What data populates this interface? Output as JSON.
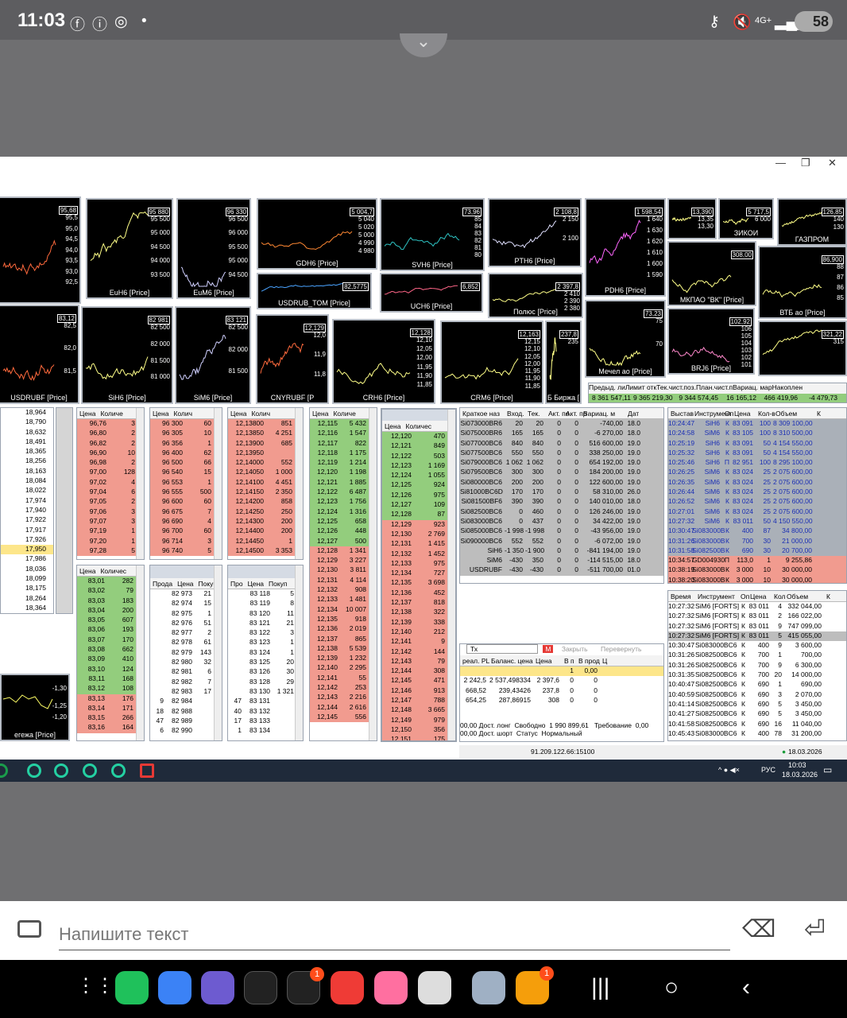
{
  "status_bar": {
    "time": "11:03",
    "battery": "58",
    "network": "4G+"
  },
  "window": {
    "min": "—",
    "restore": "❐",
    "close": "✕"
  },
  "charts": [
    {
      "caption": "",
      "price": "95,68",
      "axis": [
        "95,5",
        "95,0",
        "94,5",
        "94,0",
        "93,5",
        "93,0",
        "92,5"
      ]
    },
    {
      "caption": "EuH6 [Price]",
      "price": "95 880",
      "axis": [
        "95 500",
        "95 000",
        "94 500",
        "94 000",
        "93 500"
      ]
    },
    {
      "caption": "EuM6 [Price]",
      "price": "96 330",
      "axis": [
        "96 500",
        "96 000",
        "95 500",
        "95 000",
        "94 500"
      ]
    },
    {
      "caption": "GDH6 [Price]",
      "price": "5 004,7",
      "axis": [
        "5 040",
        "5 020",
        "5 000",
        "4 990",
        "4 980"
      ]
    },
    {
      "caption": "USDRUB_TOM [Price]",
      "price": "82,5775",
      "axis": []
    },
    {
      "caption": "SVH6 [Price]",
      "price": "73,96",
      "axis": [
        "85",
        "84",
        "83",
        "82",
        "81",
        "80"
      ]
    },
    {
      "caption": "UCH6 [Price]",
      "price": "6,852",
      "axis": []
    },
    {
      "caption": "PTH6 [Price]",
      "price": "2 108,8",
      "axis": [
        "2 150",
        "2 100"
      ]
    },
    {
      "caption": "Полюс [Price]",
      "price": "2 397,8",
      "axis": [
        "2 410",
        "2 390",
        "2 380"
      ]
    },
    {
      "caption": "PDH6 [Price]",
      "price": "1 598,54",
      "axis": [
        "1 640",
        "1 630",
        "1 620",
        "1 610",
        "1 600",
        "1 590"
      ]
    },
    {
      "caption": "",
      "price": "13,390",
      "axis": [
        "13,35",
        "13,30"
      ]
    },
    {
      "caption": "ЗИКОИ",
      "price": "5 717,5",
      "axis": [
        "6 000"
      ]
    },
    {
      "caption": "ГАЗПРОМ",
      "price": "126,85",
      "axis": [
        "140",
        "130"
      ]
    },
    {
      "caption": "МКПАО \"ВК\" [Price]",
      "price": "308,00",
      "axis": []
    },
    {
      "caption": "ВТБ ао [Price]",
      "price": "86,900",
      "axis": [
        "88",
        "87",
        "86",
        "85"
      ]
    },
    {
      "caption": "USDRUBF [Price]",
      "price": "83,12",
      "axis": [
        "82,5",
        "82,0",
        "81,5"
      ]
    },
    {
      "caption": "SiH6 [Price]",
      "price": "82 981",
      "axis": [
        "82 500",
        "82 000",
        "81 500",
        "81 000"
      ]
    },
    {
      "caption": "SiM6 [Price]",
      "price": "83 121",
      "axis": [
        "82 500",
        "82 000",
        "81 500"
      ]
    },
    {
      "caption": "CNYRUBF [P",
      "price": "12,129",
      "axis": [
        "12,0",
        "11,9",
        "11,8"
      ]
    },
    {
      "caption": "CRH6 [Price]",
      "price": "12,128",
      "axis": [
        "12,10",
        "12,05",
        "12,00",
        "11,95",
        "11,90",
        "11,85"
      ]
    },
    {
      "caption": "CRM6 [Price]",
      "price": "12,163",
      "axis": [
        "12,15",
        "12,10",
        "12,05",
        "12,00",
        "11,95",
        "11,90",
        "11,85"
      ]
    },
    {
      "caption": "Б Биржа [",
      "price": "237,8",
      "axis": [
        "235"
      ]
    },
    {
      "caption": "Мечел ао [Price]",
      "price": "73,23",
      "axis": [
        "75",
        "70"
      ]
    },
    {
      "caption": "BRJ6 [Price]",
      "price": "102,92",
      "axis": [
        "106",
        "105",
        "104",
        "103",
        "102",
        "101"
      ]
    },
    {
      "caption": "",
      "price": "321,22",
      "axis": [
        "315"
      ]
    }
  ],
  "summary_strip": {
    "headers": [
      "Предыд. ли",
      "Лимит отк",
      "Тек.чист.поз.",
      "План.чист.п",
      "Вариац. мар",
      "Накоплен"
    ],
    "values": [
      "8 361 547,11",
      "9 365 219,30",
      "9 344 574,45",
      "16 165,12",
      "466 419,96",
      "-4 479,73"
    ]
  },
  "left_list": [
    "18,964",
    "18,790",
    "18,632",
    "18,491",
    "18,365",
    "18,256",
    "18,163",
    "18,084",
    "18,022",
    "17,974",
    "17,940",
    "17,922",
    "17,917",
    "17,926",
    "17,950",
    "17,986",
    "18,036",
    "18,099",
    "18,175",
    "18,264",
    "18,364"
  ],
  "depth_headers": {
    "price": "Цена",
    "qty": "Количе",
    "qty2": "Колич",
    "qty3": "Количес",
    "sell": "Прода",
    "buy": "Покуп",
    "pro": "Про"
  },
  "depth_eu": [
    [
      "96,76",
      "3"
    ],
    [
      "96,80",
      "2"
    ],
    [
      "96,82",
      "2"
    ],
    [
      "96,90",
      "10"
    ],
    [
      "96,98",
      "2"
    ],
    [
      "97,00",
      "128"
    ],
    [
      "97,02",
      "4"
    ],
    [
      "97,04",
      "6"
    ],
    [
      "97,05",
      "2"
    ],
    [
      "97,06",
      "3"
    ],
    [
      "97,07",
      "3"
    ],
    [
      "97,19",
      "1"
    ],
    [
      "97,20",
      "1"
    ],
    [
      "97,28",
      "5"
    ]
  ],
  "depth_eum": [
    [
      "96 300",
      "60"
    ],
    [
      "96 305",
      "10"
    ],
    [
      "96 356",
      "1"
    ],
    [
      "96 400",
      "62"
    ],
    [
      "96 500",
      "66"
    ],
    [
      "96 540",
      "15"
    ],
    [
      "96 553",
      "1"
    ],
    [
      "96 555",
      "500"
    ],
    [
      "96 600",
      "60"
    ],
    [
      "96 675",
      "7"
    ],
    [
      "96 690",
      "4"
    ],
    [
      "96 700",
      "60"
    ],
    [
      "96 714",
      "3"
    ],
    [
      "96 740",
      "5"
    ]
  ],
  "depth_cny": [
    [
      "12,13800",
      "851"
    ],
    [
      "12,13850",
      "4 251"
    ],
    [
      "12,13900",
      "685"
    ],
    [
      "12,13950",
      ""
    ],
    [
      "12,14000",
      "552"
    ],
    [
      "12,14050",
      "1 000"
    ],
    [
      "12,14100",
      "4 451"
    ],
    [
      "12,14150",
      "2 350"
    ],
    [
      "12,14200",
      "858"
    ],
    [
      "12,14250",
      "250"
    ],
    [
      "12,14300",
      "200"
    ],
    [
      "12,14400",
      "200"
    ],
    [
      "12,14450",
      "1"
    ],
    [
      "12,14500",
      "3 353"
    ]
  ],
  "depth_crh_top": [
    [
      "12,115",
      "5 432"
    ],
    [
      "12,116",
      "1 547"
    ],
    [
      "12,117",
      "822"
    ],
    [
      "12,118",
      "1 175"
    ],
    [
      "12,119",
      "1 214"
    ],
    [
      "12,120",
      "1 198"
    ],
    [
      "12,121",
      "1 885"
    ],
    [
      "12,122",
      "6 487"
    ],
    [
      "12,123",
      "1 756"
    ],
    [
      "12,124",
      "1 316"
    ],
    [
      "12,125",
      "658"
    ],
    [
      "12,126",
      "448"
    ],
    [
      "12,127",
      "500"
    ],
    [
      "12,128",
      "1 341"
    ],
    [
      "12,129",
      "3 227"
    ],
    [
      "12,130",
      "3 811"
    ],
    [
      "12,131",
      "4 114"
    ],
    [
      "12,132",
      "908"
    ],
    [
      "12,133",
      "1 481"
    ],
    [
      "12,134",
      "10 007"
    ],
    [
      "12,135",
      "918"
    ],
    [
      "12,136",
      "2 019"
    ],
    [
      "12,137",
      "865"
    ],
    [
      "12,138",
      "5 539"
    ],
    [
      "12,139",
      "1 232"
    ],
    [
      "12,140",
      "2 295"
    ],
    [
      "12,141",
      "55"
    ],
    [
      "12,142",
      "253"
    ],
    [
      "12,143",
      "2 216"
    ],
    [
      "12,144",
      "2 616"
    ],
    [
      "12,145",
      "556"
    ]
  ],
  "depth_crm": [
    [
      "12,120",
      "470"
    ],
    [
      "12,121",
      "849"
    ],
    [
      "12,122",
      "503"
    ],
    [
      "12,123",
      "1 169"
    ],
    [
      "12,124",
      "1 055"
    ],
    [
      "12,125",
      "924"
    ],
    [
      "12,126",
      "975"
    ],
    [
      "12,127",
      "109"
    ],
    [
      "12,128",
      "87"
    ],
    [
      "12,129",
      "923"
    ],
    [
      "12,130",
      "2 769"
    ],
    [
      "12,131",
      "1 415"
    ],
    [
      "12,132",
      "1 452"
    ],
    [
      "12,133",
      "975"
    ],
    [
      "12,134",
      "727"
    ],
    [
      "12,135",
      "3 698"
    ],
    [
      "12,136",
      "452"
    ],
    [
      "12,137",
      "818"
    ],
    [
      "12,138",
      "322"
    ],
    [
      "12,139",
      "338"
    ],
    [
      "12,140",
      "212"
    ],
    [
      "12,141",
      "9"
    ],
    [
      "12,142",
      "144"
    ],
    [
      "12,143",
      "79"
    ],
    [
      "12,144",
      "308"
    ],
    [
      "12,145",
      "471"
    ],
    [
      "12,146",
      "913"
    ],
    [
      "12,147",
      "788"
    ],
    [
      "12,148",
      "3 665"
    ],
    [
      "12,149",
      "979"
    ],
    [
      "12,150",
      "356"
    ],
    [
      "12,151",
      "175"
    ]
  ],
  "depth_usd": [
    [
      "83,01",
      "282"
    ],
    [
      "83,02",
      "79"
    ],
    [
      "83,03",
      "183"
    ],
    [
      "83,04",
      "200"
    ],
    [
      "83,05",
      "607"
    ],
    [
      "83,06",
      "193"
    ],
    [
      "83,07",
      "170"
    ],
    [
      "83,08",
      "662"
    ],
    [
      "83,09",
      "410"
    ],
    [
      "83,10",
      "124"
    ],
    [
      "83,11",
      "168"
    ],
    [
      "83,12",
      "108"
    ],
    [
      "83,13",
      "176"
    ],
    [
      "83,14",
      "171"
    ],
    [
      "83,15",
      "266"
    ],
    [
      "83,16",
      "164"
    ]
  ],
  "depth_sih": [
    [
      "",
      "82 973",
      "21"
    ],
    [
      "",
      "82 974",
      "15"
    ],
    [
      "",
      "82 975",
      "1"
    ],
    [
      "",
      "82 976",
      "51"
    ],
    [
      "",
      "82 977",
      "2"
    ],
    [
      "",
      "82 978",
      "61"
    ],
    [
      "",
      "82 979",
      "143"
    ],
    [
      "",
      "82 980",
      "32"
    ],
    [
      "",
      "82 981",
      "6"
    ],
    [
      "",
      "82 982",
      "7"
    ],
    [
      "",
      "82 983",
      "17"
    ],
    [
      "9",
      "82 984",
      ""
    ],
    [
      "18",
      "82 988",
      ""
    ],
    [
      "47",
      "82 989",
      ""
    ],
    [
      "6",
      "82 990",
      ""
    ]
  ],
  "depth_sim": [
    [
      "",
      "83 118",
      "5"
    ],
    [
      "",
      "83 119",
      "8"
    ],
    [
      "",
      "83 120",
      "11"
    ],
    [
      "",
      "83 121",
      "21"
    ],
    [
      "",
      "83 122",
      "3"
    ],
    [
      "",
      "83 123",
      "1"
    ],
    [
      "",
      "83 124",
      "1"
    ],
    [
      "",
      "83 125",
      "20"
    ],
    [
      "",
      "83 126",
      "30"
    ],
    [
      "",
      "83 128",
      "29"
    ],
    [
      "",
      "83 130",
      "1 321"
    ],
    [
      "47",
      "83 131",
      ""
    ],
    [
      "40",
      "83 132",
      ""
    ],
    [
      "17",
      "83 133",
      ""
    ],
    [
      "1",
      "83 134",
      ""
    ]
  ],
  "positions": {
    "headers": [
      "Краткое наз",
      "Вход.",
      "Тек.",
      "Акт. по",
      "Акт. пр",
      "Вариац. м",
      "Дат"
    ],
    "rows": [
      [
        "Si073000BR6",
        "20",
        "20",
        "0",
        "0",
        "-740,00",
        "18.0"
      ],
      [
        "Si075000BR6",
        "165",
        "165",
        "0",
        "0",
        "-6 270,00",
        "18.0"
      ],
      [
        "Si077000BC6",
        "840",
        "840",
        "0",
        "0",
        "516 600,00",
        "19.0"
      ],
      [
        "Si077500BC6",
        "550",
        "550",
        "0",
        "0",
        "338 250,00",
        "19.0"
      ],
      [
        "Si079000BC6",
        "1 062",
        "1 062",
        "0",
        "0",
        "654 192,00",
        "19.0"
      ],
      [
        "Si079500BC6",
        "300",
        "300",
        "0",
        "0",
        "184 200,00",
        "19.0"
      ],
      [
        "Si080000BC6",
        "200",
        "200",
        "0",
        "0",
        "122 600,00",
        "19.0"
      ],
      [
        "Si81000BC6D",
        "170",
        "170",
        "0",
        "0",
        "58 310,00",
        "26.0"
      ],
      [
        "Si081500BF6",
        "390",
        "390",
        "0",
        "0",
        "140 010,00",
        "18.0"
      ],
      [
        "Si082500BC6",
        "0",
        "460",
        "0",
        "0",
        "126 246,00",
        "19.0"
      ],
      [
        "Si083000BC6",
        "0",
        "437",
        "0",
        "0",
        "34 422,00",
        "19.0"
      ],
      [
        "Si085000BC6",
        "-1 998",
        "-1 998",
        "0",
        "0",
        "-43 956,00",
        "19.0"
      ],
      [
        "Si090000BC6",
        "552",
        "552",
        "0",
        "0",
        "-6 072,00",
        "19.0"
      ],
      [
        "SiH6",
        "-1 350",
        "-1 900",
        "0",
        "0",
        "-841 194,00",
        "19.0"
      ],
      [
        "SiM6",
        "-430",
        "350",
        "0",
        "0",
        "-114 515,00",
        "18.0"
      ],
      [
        "USDRUBF",
        "-430",
        "-430",
        "0",
        "0",
        "-511 700,00",
        "01.0"
      ]
    ]
  },
  "orders": {
    "headers": [
      "Выстав",
      "Инструмент",
      "Оп",
      "Цена",
      "Кол-в",
      "Объем",
      "К"
    ],
    "rows": [
      [
        "10:24:47",
        "SiH6",
        "К",
        "83 091",
        "100",
        "8 309 100,00"
      ],
      [
        "10:24:58",
        "SiM6",
        "К",
        "83 105",
        "100",
        "8 310 500,00"
      ],
      [
        "10:25:19",
        "SiH6",
        "К",
        "83 091",
        "50",
        "4 154 550,00"
      ],
      [
        "10:25:32",
        "SiH6",
        "К",
        "83 091",
        "50",
        "4 154 550,00"
      ],
      [
        "10:25:46",
        "SiH6",
        "П",
        "82 951",
        "100",
        "8 295 100,00"
      ],
      [
        "10:26:25",
        "SiM6",
        "К",
        "83 024",
        "25",
        "2 075 600,00"
      ],
      [
        "10:26:35",
        "SiM6",
        "К",
        "83 024",
        "25",
        "2 075 600,00"
      ],
      [
        "10:26:44",
        "SiM6",
        "К",
        "83 024",
        "25",
        "2 075 600,00"
      ],
      [
        "10:26:52",
        "SiM6",
        "К",
        "83 024",
        "25",
        "2 075 600,00"
      ],
      [
        "10:27:01",
        "SiM6",
        "К",
        "83 024",
        "25",
        "2 075 600,00"
      ],
      [
        "10:27:32",
        "SiM6",
        "К",
        "83 011",
        "50",
        "4 150 550,00"
      ],
      [
        "10:30:47",
        "Si083000B",
        "К",
        "400",
        "87",
        "34 800,00"
      ],
      [
        "10:31:26",
        "Si083000B",
        "К",
        "700",
        "30",
        "21 000,00"
      ],
      [
        "10:31:58",
        "Si082500B",
        "К",
        "690",
        "30",
        "20 700,00"
      ],
      [
        "10:34:57",
        "GD004930",
        "П",
        "113,0",
        "1",
        "9 255,86"
      ],
      [
        "10:38:19",
        "Si083000B",
        "К",
        "3 000",
        "10",
        "30 000,00"
      ],
      [
        "10:38:20",
        "Si083000B",
        "К",
        "3 000",
        "10",
        "30 000,00"
      ]
    ]
  },
  "trades": {
    "headers": [
      "Время",
      "Инструмент",
      "Оп",
      "Цена",
      "Кол",
      "Объем",
      "К"
    ],
    "rows": [
      [
        "10:27:32",
        "SiM6 [FORTS]",
        "К",
        "83 011",
        "4",
        "332 044,00"
      ],
      [
        "10:27:32",
        "SiM6 [FORTS]",
        "К",
        "83 011",
        "2",
        "166 022,00"
      ],
      [
        "10:27:32",
        "SiM6 [FORTS]",
        "К",
        "83 011",
        "9",
        "747 099,00"
      ],
      [
        "10:27:32",
        "SiM6 [FORTS]",
        "К",
        "83 011",
        "5",
        "415 055,00"
      ],
      [
        "10:30:47",
        "Si083000BC6",
        "К",
        "400",
        "9",
        "3 600,00"
      ],
      [
        "10:31:26",
        "Si082500BC6",
        "К",
        "700",
        "1",
        "700,00"
      ],
      [
        "10:31:26",
        "Si082500BC6",
        "К",
        "700",
        "9",
        "6 300,00"
      ],
      [
        "10:31:35",
        "Si082500BC6",
        "К",
        "700",
        "20",
        "14 000,00"
      ],
      [
        "10:40:47",
        "Si082500BC6",
        "К",
        "690",
        "1",
        "690,00"
      ],
      [
        "10:40:59",
        "Si082500BC6",
        "К",
        "690",
        "3",
        "2 070,00"
      ],
      [
        "10:41:14",
        "Si082500BC6",
        "К",
        "690",
        "5",
        "3 450,00"
      ],
      [
        "10:41:27",
        "Si082500BC6",
        "К",
        "690",
        "5",
        "3 450,00"
      ],
      [
        "10:41:58",
        "Si082500BC6",
        "К",
        "690",
        "16",
        "11 040,00"
      ],
      [
        "10:45:43",
        "Si083000BC6",
        "К",
        "400",
        "78",
        "31 200,00"
      ]
    ]
  },
  "trade_panel": {
    "select": "Тх",
    "m_button": "M",
    "close_label": "Закрыть",
    "flip_label": "Перевернуть",
    "headers": [
      "реал. PL",
      "Баланс. цена",
      "Цена",
      "В п",
      "В прод",
      "Ц"
    ],
    "yellow_row": [
      "",
      "",
      "",
      "1",
      "0,00",
      ""
    ],
    "rows": [
      [
        "2 242,5",
        "2 537,498334",
        "2 397,6",
        "0",
        "0",
        ""
      ],
      [
        "668,52",
        "239,43426",
        "237,8",
        "0",
        "0",
        ""
      ],
      [
        "654,25",
        "287,86915",
        "308",
        "0",
        "0",
        ""
      ]
    ],
    "footer": {
      "l1": "00,00 Дост. лонг",
      "free_label": "Свободно",
      "free_value": "1 990 899,61",
      "req_label": "Требование",
      "req_value": "0,00",
      "l2": "00,00 Дост. шорт",
      "status_label": "Статус",
      "status_value": "Нормальный"
    }
  },
  "statusline": {
    "server": "91.209.122.66:15100",
    "date": "18.03.2026"
  },
  "taskbar": {
    "lang": "РУС",
    "time": "10:03",
    "date": "18.03.2026"
  },
  "message": {
    "placeholder": "Напишите текст"
  },
  "dock_badges": {
    "a": "1",
    "b": "1"
  }
}
